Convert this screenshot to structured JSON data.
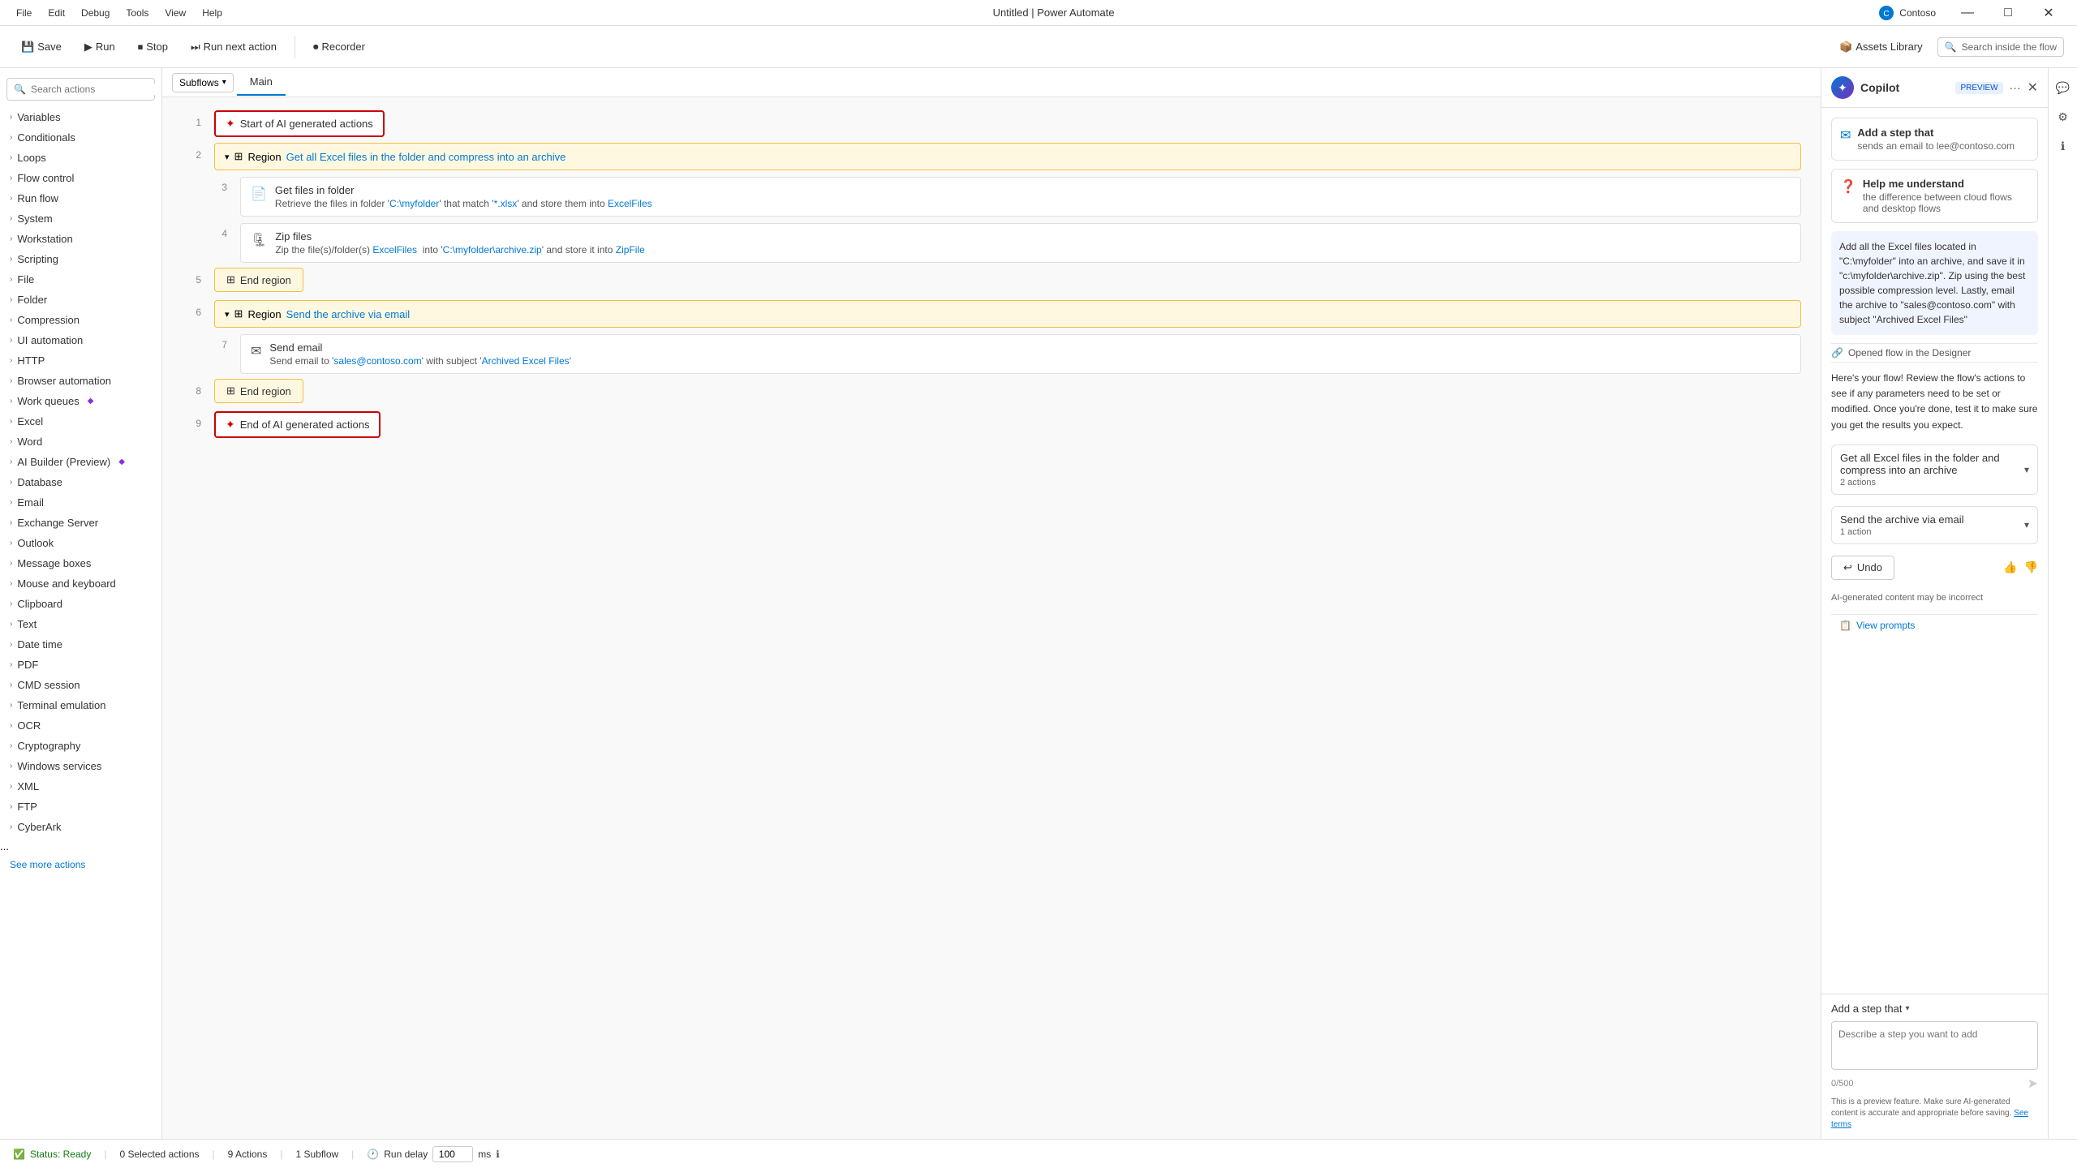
{
  "titlebar": {
    "menus": [
      "File",
      "Edit",
      "Debug",
      "Tools",
      "View",
      "Help"
    ],
    "title": "Untitled | Power Automate",
    "contoso": "Contoso",
    "min_btn": "—",
    "max_btn": "□",
    "close_btn": "✕"
  },
  "toolbar": {
    "save_label": "Save",
    "run_label": "Run",
    "stop_label": "Stop",
    "next_action_label": "Run next action",
    "recorder_label": "Recorder",
    "assets_label": "Assets Library",
    "search_inside_placeholder": "Search inside the flow"
  },
  "subflows": {
    "btn_label": "Subflows",
    "main_tab": "Main"
  },
  "sidebar": {
    "search_placeholder": "Search actions",
    "items": [
      {
        "label": "Variables"
      },
      {
        "label": "Conditionals"
      },
      {
        "label": "Loops"
      },
      {
        "label": "Flow control"
      },
      {
        "label": "Run flow"
      },
      {
        "label": "System"
      },
      {
        "label": "Workstation"
      },
      {
        "label": "Scripting"
      },
      {
        "label": "File"
      },
      {
        "label": "Folder"
      },
      {
        "label": "Compression"
      },
      {
        "label": "UI automation"
      },
      {
        "label": "HTTP"
      },
      {
        "label": "Browser automation"
      },
      {
        "label": "Work queues"
      },
      {
        "label": "Excel"
      },
      {
        "label": "Word"
      },
      {
        "label": "AI Builder (Preview)"
      },
      {
        "label": "Database"
      },
      {
        "label": "Email"
      },
      {
        "label": "Exchange Server"
      },
      {
        "label": "Outlook"
      },
      {
        "label": "Message boxes"
      },
      {
        "label": "Mouse and keyboard"
      },
      {
        "label": "Clipboard"
      },
      {
        "label": "Text"
      },
      {
        "label": "Date time"
      },
      {
        "label": "PDF"
      },
      {
        "label": "CMD session"
      },
      {
        "label": "Terminal emulation"
      },
      {
        "label": "OCR"
      },
      {
        "label": "Cryptography"
      },
      {
        "label": "Windows services"
      },
      {
        "label": "XML"
      },
      {
        "label": "FTP"
      },
      {
        "label": "CyberArk"
      }
    ],
    "see_more": "See more actions"
  },
  "flow": {
    "rows": [
      {
        "num": "1",
        "type": "ai_start",
        "label": "Start of AI generated actions"
      },
      {
        "num": "2",
        "type": "region",
        "region_name": "Get all Excel files in the folder and compress into an archive",
        "children": [
          {
            "num": "3",
            "type": "action",
            "title": "Get files in folder",
            "desc_parts": [
              {
                "text": "Retrieve the files in folder '"
              },
              {
                "text": "C:\\myfolder",
                "highlight": true
              },
              {
                "text": "' that match '"
              },
              {
                "text": "*.xlsx",
                "highlight": true
              },
              {
                "text": "' and store them into "
              },
              {
                "text": "ExcelFiles",
                "highlight": true
              }
            ]
          },
          {
            "num": "4",
            "type": "action",
            "title": "Zip files",
            "desc_parts": [
              {
                "text": "Zip the file(s)/folder(s) "
              },
              {
                "text": "ExcelFiles",
                "highlight": true
              },
              {
                "text": "  into '"
              },
              {
                "text": "C:\\myfolder\\archive.zip",
                "highlight": true
              },
              {
                "text": "' and store it into "
              },
              {
                "text": "ZipFile",
                "highlight": true
              }
            ]
          }
        ]
      },
      {
        "num": "5",
        "type": "end_region"
      },
      {
        "num": "6",
        "type": "region",
        "region_name": "Send the archive via email",
        "children": [
          {
            "num": "7",
            "type": "action",
            "title": "Send email",
            "desc_parts": [
              {
                "text": "Send email to '"
              },
              {
                "text": "sales@contoso.com",
                "highlight": true
              },
              {
                "text": "' with subject '"
              },
              {
                "text": "Archived Excel Files",
                "highlight": true
              },
              {
                "text": "'"
              }
            ]
          }
        ]
      },
      {
        "num": "8",
        "type": "end_region"
      },
      {
        "num": "9",
        "type": "ai_end",
        "label": "End of AI generated actions"
      }
    ]
  },
  "copilot": {
    "title": "Copilot",
    "preview_label": "PREVIEW",
    "suggestions": [
      {
        "icon": "✉",
        "title": "Add a step that",
        "desc": "sends an email to lee@contoso.com"
      },
      {
        "icon": "?",
        "title": "Help me understand",
        "desc": "the difference between cloud flows and desktop flows"
      }
    ],
    "ai_message": "Add all the Excel files located in \"C:\\myfolder\" into an archive, and save it in \"c:\\myfolder\\archive.zip\". Zip using the best possible compression level. Lastly, email the archive to \"sales@contoso.com\" with subject \"Archived Excel Files\"",
    "opened_flow_label": "Opened flow in the Designer",
    "response_text": "Here's your flow! Review the flow's actions to see if any parameters need to be set or modified. Once you're done, test it to make sure you get the results you expect.",
    "flow_sections": [
      {
        "title": "Get all Excel files in the folder and compress into an archive",
        "count": "2 actions"
      },
      {
        "title": "Send the archive via email",
        "count": "1 action"
      }
    ],
    "undo_label": "Undo",
    "disclaimer": "AI-generated content may be incorrect",
    "view_prompts_label": "View prompts",
    "add_step_label": "Add a step that",
    "textarea_placeholder": "Describe a step you want to add",
    "char_count": "0/500",
    "full_disclaimer": "This is a preview feature. Make sure AI-generated content is accurate and appropriate before saving.",
    "see_terms": "See terms"
  },
  "statusbar": {
    "status": "Status: Ready",
    "selected_actions": "0 Selected actions",
    "total_actions": "9 Actions",
    "subflows": "1 Subflow",
    "run_delay_label": "Run delay",
    "delay_value": "100",
    "delay_unit": "ms"
  }
}
